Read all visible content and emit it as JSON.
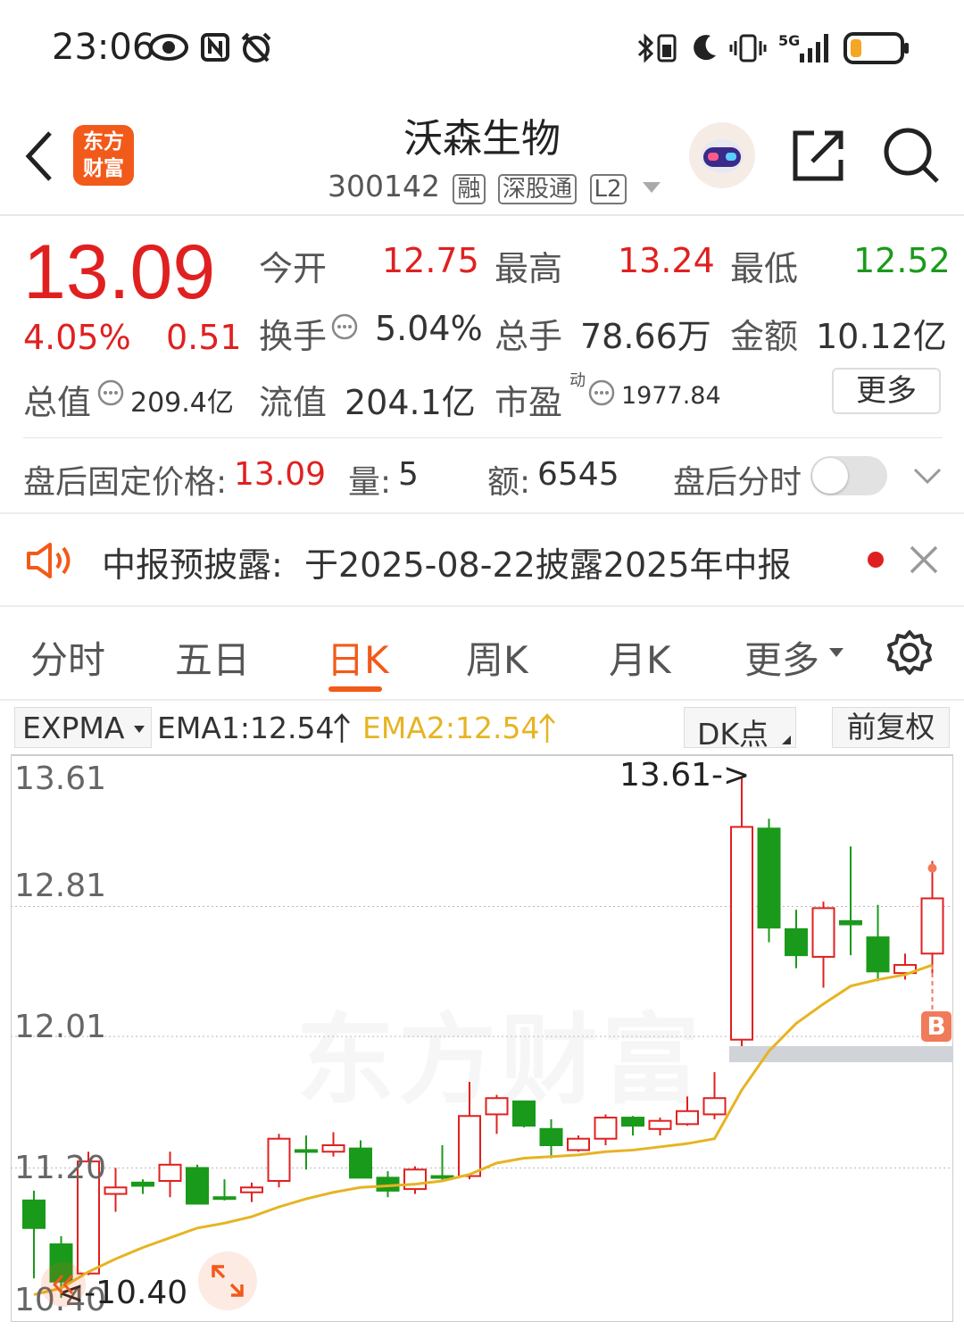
{
  "status_bar": {
    "time": "23:06"
  },
  "header": {
    "logo_line1": "东方",
    "logo_line2": "财富",
    "title": "沃森生物",
    "code": "300142",
    "tags": [
      "融",
      "深股通",
      "L2"
    ]
  },
  "quote": {
    "price": "13.09",
    "change_pct": "4.05%",
    "change": "0.51",
    "open_label": "今开",
    "open": "12.75",
    "high_label": "最高",
    "high": "13.24",
    "low_label": "最低",
    "low": "12.52",
    "turnover_label": "换手",
    "turnover": "5.04%",
    "volume_label": "总手",
    "volume": "78.66万",
    "amount_label": "金额",
    "amount": "10.12亿",
    "mktcap_label": "总值",
    "mktcap": "209.4亿",
    "float_label": "流值",
    "float": "204.1亿",
    "pe_label": "市盈",
    "pe_sup": "动",
    "pe": "1977.84",
    "more_button": "更多"
  },
  "after_hours": {
    "price_label": "盘后固定价格:",
    "price": "13.09",
    "vol_label": "量:",
    "vol": "5",
    "amt_label": "额:",
    "amt": "6545",
    "timeshare_label": "盘后分时"
  },
  "notice": {
    "text": "中报预披露:  于2025-08-22披露2025年中报"
  },
  "tabs": [
    "分时",
    "五日",
    "日K",
    "周K",
    "月K",
    "更多"
  ],
  "active_tab": "日K",
  "indicator_bar": {
    "selector": "EXPMA",
    "ema1": "EMA1:12.54",
    "ema2": "EMA2:12.54",
    "dk_button": "DK点",
    "adjust_button": "前复权"
  },
  "colors": {
    "up": "#e02020",
    "down": "#1a9a1a",
    "ema": "#e6b422",
    "accent": "#f25a1a"
  },
  "chart_data": {
    "type": "candlestick",
    "y_ticks": [
      "13.61",
      "12.81",
      "12.01",
      "11.20",
      "10.40"
    ],
    "ylim": [
      10.4,
      13.61
    ],
    "max_marker": "13.61->",
    "min_marker": "<-10.40",
    "buy_marker": "B",
    "watermark": "东方财富",
    "candles": [
      {
        "o": 11.0,
        "c": 10.83,
        "h": 11.06,
        "l": 10.52
      },
      {
        "o": 10.73,
        "c": 10.5,
        "h": 10.78,
        "l": 10.4
      },
      {
        "o": 10.55,
        "c": 11.24,
        "h": 11.3,
        "l": 10.54
      },
      {
        "o": 11.04,
        "c": 11.08,
        "h": 11.2,
        "l": 10.93
      },
      {
        "o": 11.11,
        "c": 11.09,
        "h": 11.13,
        "l": 11.04
      },
      {
        "o": 11.12,
        "c": 11.22,
        "h": 11.3,
        "l": 11.02
      },
      {
        "o": 11.2,
        "c": 10.98,
        "h": 11.22,
        "l": 10.98
      },
      {
        "o": 11.02,
        "c": 11.01,
        "h": 11.13,
        "l": 11.0
      },
      {
        "o": 11.05,
        "c": 11.08,
        "h": 11.11,
        "l": 10.99
      },
      {
        "o": 11.12,
        "c": 11.38,
        "h": 11.41,
        "l": 11.08
      },
      {
        "o": 11.31,
        "c": 11.3,
        "h": 11.4,
        "l": 11.19
      },
      {
        "o": 11.3,
        "c": 11.34,
        "h": 11.42,
        "l": 11.27
      },
      {
        "o": 11.32,
        "c": 11.14,
        "h": 11.37,
        "l": 11.14
      },
      {
        "o": 11.14,
        "c": 11.06,
        "h": 11.18,
        "l": 11.02
      },
      {
        "o": 11.07,
        "c": 11.19,
        "h": 11.21,
        "l": 11.04
      },
      {
        "o": 11.15,
        "c": 11.14,
        "h": 11.34,
        "l": 11.12
      },
      {
        "o": 11.15,
        "c": 11.52,
        "h": 11.73,
        "l": 11.13
      },
      {
        "o": 11.53,
        "c": 11.63,
        "h": 11.65,
        "l": 11.41
      },
      {
        "o": 11.61,
        "c": 11.46,
        "h": 11.61,
        "l": 11.45
      },
      {
        "o": 11.44,
        "c": 11.34,
        "h": 11.5,
        "l": 11.26
      },
      {
        "o": 11.31,
        "c": 11.38,
        "h": 11.4,
        "l": 11.3
      },
      {
        "o": 11.38,
        "c": 11.51,
        "h": 11.53,
        "l": 11.34
      },
      {
        "o": 11.51,
        "c": 11.46,
        "h": 11.52,
        "l": 11.4
      },
      {
        "o": 11.44,
        "c": 11.49,
        "h": 11.51,
        "l": 11.4
      },
      {
        "o": 11.47,
        "c": 11.55,
        "h": 11.64,
        "l": 11.46
      },
      {
        "o": 11.53,
        "c": 11.63,
        "h": 11.79,
        "l": 11.5
      },
      {
        "o": 11.99,
        "c": 13.3,
        "h": 13.61,
        "l": 11.95
      },
      {
        "o": 13.29,
        "c": 12.68,
        "h": 13.35,
        "l": 12.59
      },
      {
        "o": 12.67,
        "c": 12.51,
        "h": 12.79,
        "l": 12.43
      },
      {
        "o": 12.5,
        "c": 12.8,
        "h": 12.84,
        "l": 12.31
      },
      {
        "o": 12.72,
        "c": 12.7,
        "h": 13.18,
        "l": 12.51
      },
      {
        "o": 12.62,
        "c": 12.41,
        "h": 12.82,
        "l": 12.35
      },
      {
        "o": 12.4,
        "c": 12.45,
        "h": 12.52,
        "l": 12.36
      },
      {
        "o": 12.52,
        "c": 12.86,
        "h": 13.09,
        "l": 12.4
      }
    ],
    "ema": [
      10.42,
      10.46,
      10.56,
      10.64,
      10.71,
      10.77,
      10.83,
      10.86,
      10.9,
      10.96,
      11.01,
      11.05,
      11.08,
      11.09,
      11.1,
      11.12,
      11.16,
      11.23,
      11.26,
      11.27,
      11.28,
      11.3,
      11.31,
      11.33,
      11.35,
      11.38,
      11.68,
      11.92,
      12.09,
      12.21,
      12.32,
      12.36,
      12.39,
      12.45
    ]
  }
}
